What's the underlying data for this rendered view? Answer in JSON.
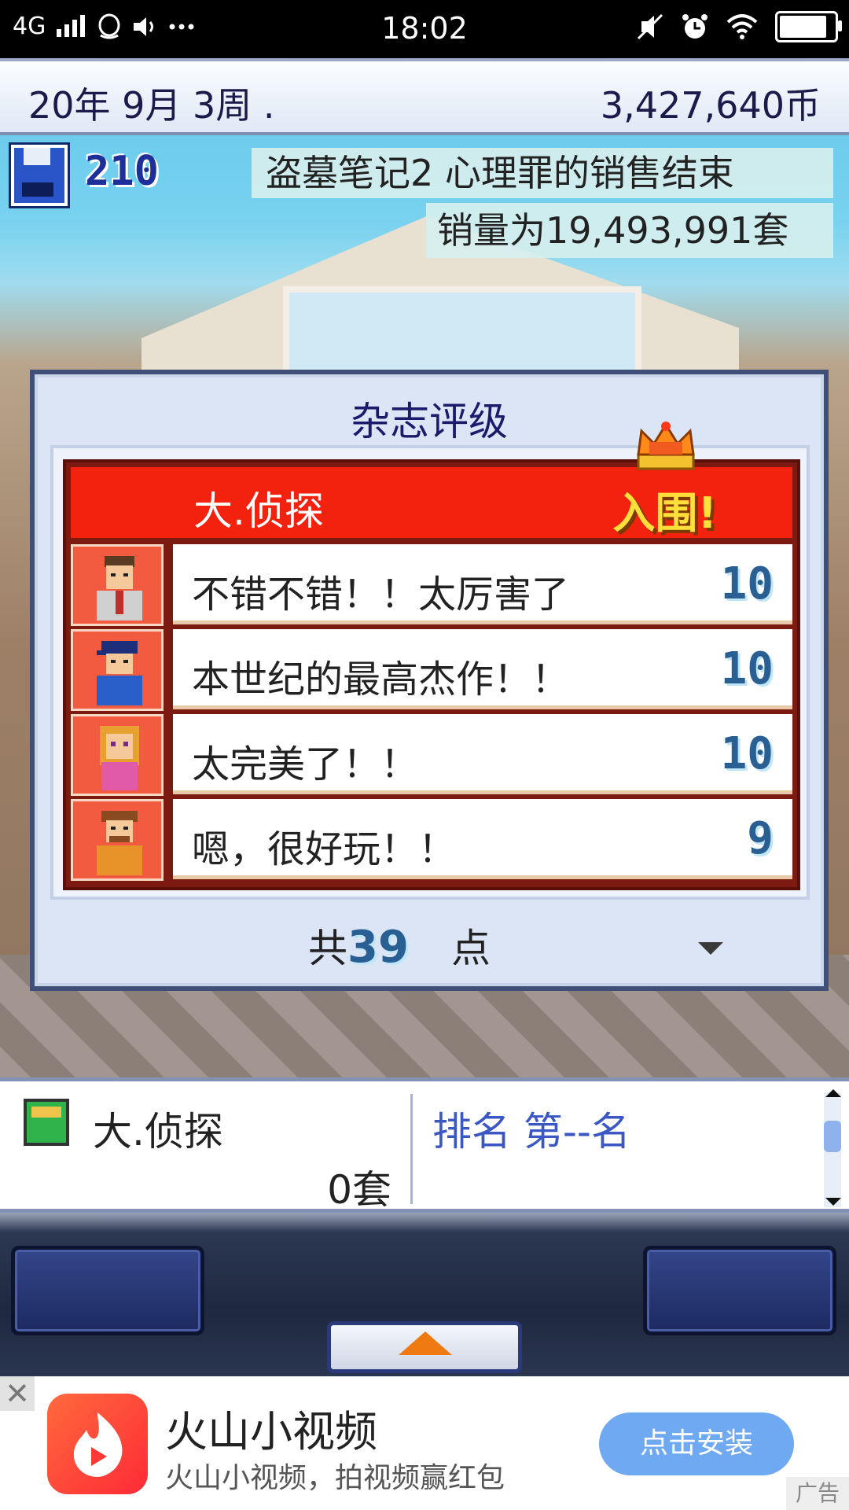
{
  "status_bar": {
    "network": "4G",
    "time": "18:02",
    "icons": [
      "signal-icon",
      "qq-icon",
      "speaker-icon",
      "more-icon",
      "vibrate-off-icon",
      "alarm-icon",
      "wifi-icon",
      "battery-icon"
    ],
    "battery_level": 0.95
  },
  "hud": {
    "date": "20年 9月 3周 .",
    "money": "3,427,640币",
    "save_count": "210",
    "news_line1": "盗墓笔记2  心理罪的销售结束",
    "news_line2": "销量为19,493,991套"
  },
  "dialog": {
    "title": "杂志评级",
    "game_name": "大.侦探",
    "badge": "入围",
    "badge_bang": "!",
    "reviews": [
      {
        "text": "不错不错！！太厉害了",
        "score": "10",
        "avatar": "reviewer-1-icon"
      },
      {
        "text": "本世纪的最高杰作！！",
        "score": "10",
        "avatar": "reviewer-2-icon"
      },
      {
        "text": "太完美了！！",
        "score": "10",
        "avatar": "reviewer-3-icon"
      },
      {
        "text": "嗯，很好玩！！",
        "score": "9",
        "avatar": "reviewer-4-icon"
      }
    ],
    "total_prefix": "共",
    "total_score": "39",
    "total_suffix": "点"
  },
  "info_panel": {
    "game_name": "大.侦探",
    "sales": "0套",
    "rank": "排名 第--名"
  },
  "ad": {
    "close": "✕",
    "title": "火山小视频",
    "subtitle": "火山小视频，拍视频赢红包",
    "button": "点击安装",
    "tag": "广告"
  },
  "colors": {
    "panel_red": "#f2220f",
    "avatar_bg": "#f25b3f",
    "score_blue": "#2a5f94",
    "rank_blue": "#3b57c4",
    "ad_button": "#6fa9f2"
  }
}
